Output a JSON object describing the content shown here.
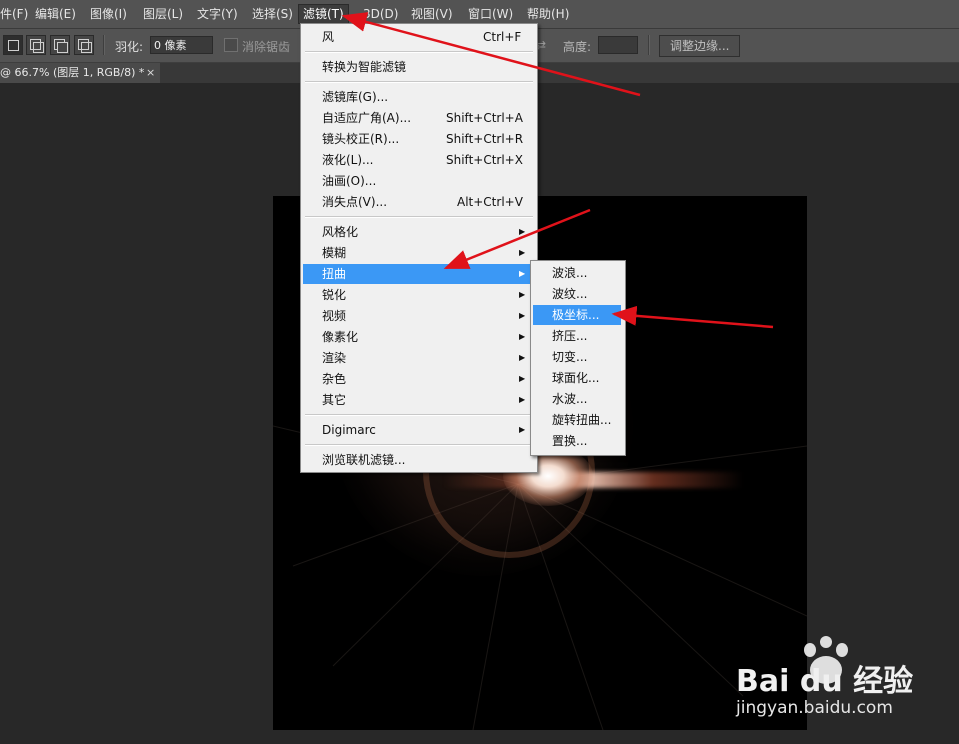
{
  "menubar": {
    "items": [
      "件(F)",
      "编辑(E)",
      "图像(I)",
      "图层(L)",
      "文字(Y)",
      "选择(S)",
      "滤镜(T)",
      "3D(D)",
      "视图(V)",
      "窗口(W)",
      "帮助(H)"
    ],
    "active": "滤镜(T)"
  },
  "options": {
    "feather_label": "羽化:",
    "feather_value": "0 像素",
    "antialias_label": "消除锯齿",
    "height_label": "高度:",
    "refine_edge_button": "调整边缘..."
  },
  "document_tab": {
    "title": "@ 66.7% (图层 1, RGB/8) *",
    "close": "×"
  },
  "filter_menu": {
    "items": [
      {
        "label": "风",
        "shortcut": "Ctrl+F"
      },
      {
        "label": "转换为智能滤镜"
      },
      {
        "label": "滤镜库(G)..."
      },
      {
        "label": "自适应广角(A)...",
        "shortcut": "Shift+Ctrl+A"
      },
      {
        "label": "镜头校正(R)...",
        "shortcut": "Shift+Ctrl+R"
      },
      {
        "label": "液化(L)...",
        "shortcut": "Shift+Ctrl+X"
      },
      {
        "label": "油画(O)..."
      },
      {
        "label": "消失点(V)...",
        "shortcut": "Alt+Ctrl+V"
      },
      {
        "label": "风格化",
        "submenu": true
      },
      {
        "label": "模糊",
        "submenu": true
      },
      {
        "label": "扭曲",
        "submenu": true,
        "highlighted": true
      },
      {
        "label": "锐化",
        "submenu": true
      },
      {
        "label": "视频",
        "submenu": true
      },
      {
        "label": "像素化",
        "submenu": true
      },
      {
        "label": "渲染",
        "submenu": true
      },
      {
        "label": "杂色",
        "submenu": true
      },
      {
        "label": "其它",
        "submenu": true
      },
      {
        "label": "Digimarc",
        "submenu": true
      },
      {
        "label": "浏览联机滤镜..."
      }
    ]
  },
  "distort_submenu": {
    "items": [
      {
        "label": "波浪..."
      },
      {
        "label": "波纹..."
      },
      {
        "label": "极坐标...",
        "highlighted": true
      },
      {
        "label": "挤压..."
      },
      {
        "label": "切变..."
      },
      {
        "label": "球面化..."
      },
      {
        "label": "水波..."
      },
      {
        "label": "旋转扭曲..."
      },
      {
        "label": "置换..."
      }
    ]
  },
  "icons": {
    "submenu_arrow": "▶"
  },
  "watermark": {
    "brand": "Bai du 经验",
    "url": "jingyan.baidu.com"
  },
  "colors": {
    "highlight": "#3b98f5",
    "annotation_arrow": "#e0121a"
  }
}
